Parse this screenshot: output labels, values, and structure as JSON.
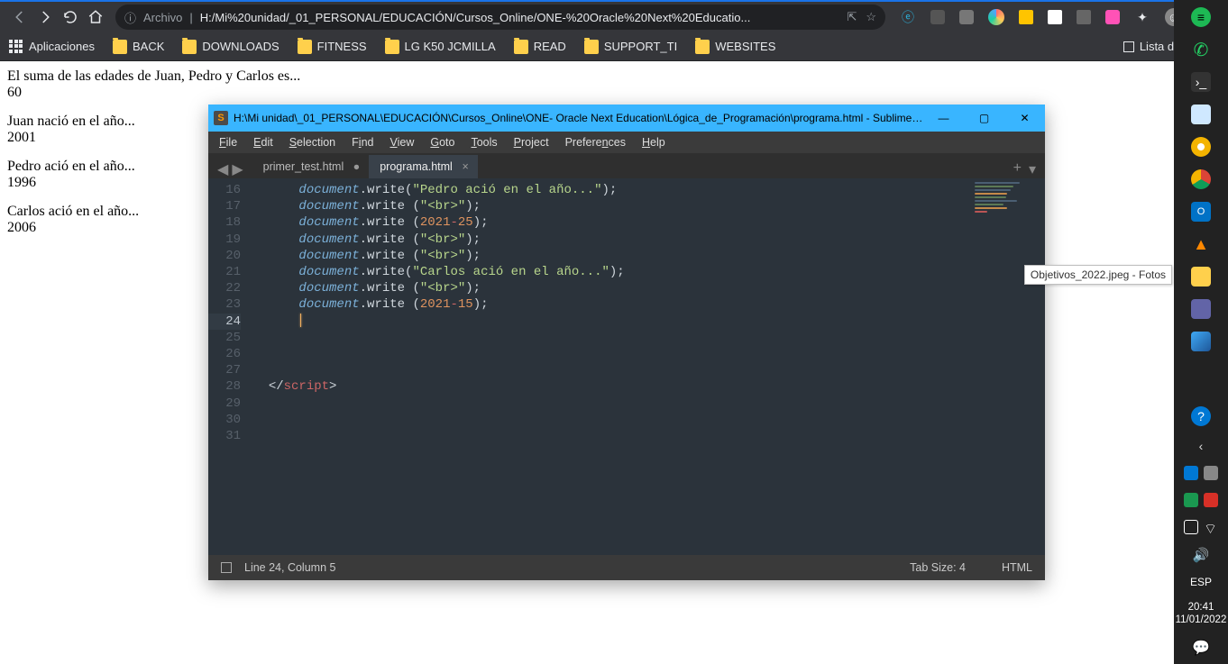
{
  "browser": {
    "url_prefix_label": "Archivo",
    "url": "H:/Mi%20unidad/_01_PERSONAL/EDUCACIÓN/Cursos_Online/ONE-%20Oracle%20Next%20Educatio...",
    "apps_label": "Aplicaciones",
    "bookmarks": [
      "BACK",
      "DOWNLOADS",
      "FITNESS",
      "LG K50 JCMILLA",
      "READ",
      "SUPPORT_TI",
      "WEBSITES"
    ],
    "reading_list_label": "Lista de lectura"
  },
  "page": {
    "line1": "El suma de las edades de Juan, Pedro y Carlos es...",
    "val1": "60",
    "line2": "Juan nació en el año...",
    "val2": "2001",
    "line3": "Pedro ació en el año...",
    "val3": "1996",
    "line4": "Carlos ació en el año...",
    "val4": "2006"
  },
  "sublime": {
    "title": "H:\\Mi unidad\\_01_PERSONAL\\EDUCACIÓN\\Cursos_Online\\ONE- Oracle Next Education\\Lógica_de_Programación\\programa.html - Sublime Te...",
    "menu": [
      "File",
      "Edit",
      "Selection",
      "Find",
      "View",
      "Goto",
      "Tools",
      "Project",
      "Preferences",
      "Help"
    ],
    "tabs": {
      "inactive": "primer_test.html",
      "active": "programa.html"
    },
    "gutter": [
      "16",
      "17",
      "18",
      "19",
      "20",
      "21",
      "22",
      "23",
      "24",
      "25",
      "26",
      "27",
      "28",
      "29",
      "30",
      "31"
    ],
    "code": {
      "l16": {
        "a": "document",
        "b": ".write(",
        "s": "\"Pedro ació en el año...\"",
        "c": ");"
      },
      "l17": {
        "a": "document",
        "b": ".write (",
        "s": "\"<br>\"",
        "c": ");"
      },
      "l18": {
        "a": "document",
        "b": ".write (",
        "n1": "2021",
        "op": "-",
        "n2": "25",
        "c": ");"
      },
      "l19": {
        "a": "document",
        "b": ".write (",
        "s": "\"<br>\"",
        "c": ");"
      },
      "l20": {
        "a": "document",
        "b": ".write (",
        "s": "\"<br>\"",
        "c": ");"
      },
      "l21": {
        "a": "document",
        "b": ".write(",
        "s": "\"Carlos ació en el año...\"",
        "c": ");"
      },
      "l22": {
        "a": "document",
        "b": ".write (",
        "s": "\"<br>\"",
        "c": ");"
      },
      "l23": {
        "a": "document",
        "b": ".write (",
        "n1": "2021",
        "op": "-",
        "n2": "15",
        "c": ");"
      },
      "l28": {
        "open": "</",
        "tag": "script",
        "close": ">"
      }
    },
    "status": {
      "pos": "Line 24, Column 5",
      "tabsize": "Tab Size: 4",
      "syntax": "HTML"
    }
  },
  "tooltip": "Objetivos_2022.jpeg - Fotos",
  "tray": {
    "lang": "ESP",
    "time": "20:41",
    "date": "11/01/2022"
  }
}
